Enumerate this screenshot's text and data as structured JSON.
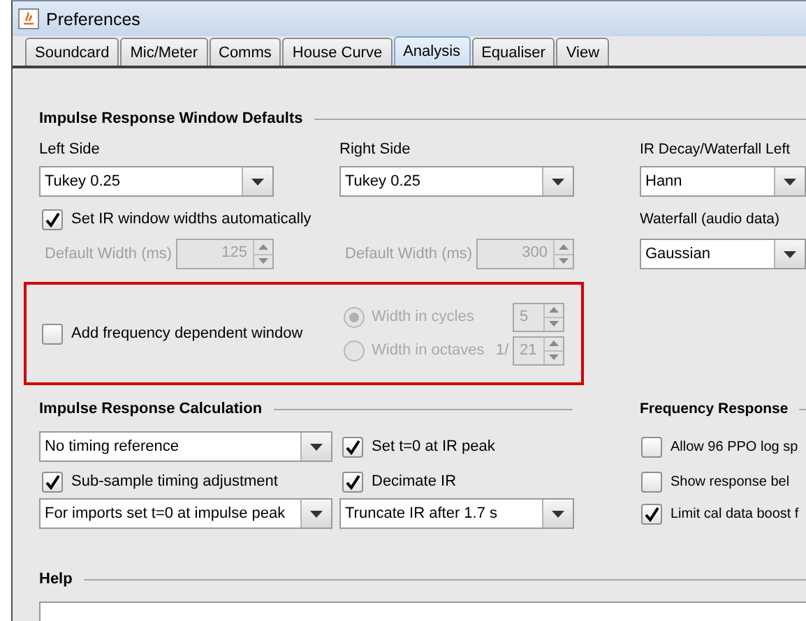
{
  "window": {
    "title": "Preferences"
  },
  "tabs": [
    {
      "label": "Soundcard",
      "selected": false
    },
    {
      "label": "Mic/Meter",
      "selected": false
    },
    {
      "label": "Comms",
      "selected": false
    },
    {
      "label": "House Curve",
      "selected": false
    },
    {
      "label": "Analysis",
      "selected": true
    },
    {
      "label": "Equaliser",
      "selected": false
    },
    {
      "label": "View",
      "selected": false
    }
  ],
  "ir_window_defaults": {
    "title": "Impulse Response Window Defaults",
    "left_side": {
      "label": "Left Side",
      "value": "Tukey 0.25"
    },
    "right_side": {
      "label": "Right Side",
      "value": "Tukey 0.25"
    },
    "ir_decay_left": {
      "label": "IR Decay/Waterfall Left",
      "value": "Hann"
    },
    "auto_widths": {
      "label": "Set IR window widths automatically",
      "checked": true
    },
    "waterfall": {
      "label": "Waterfall (audio data)",
      "value": "Gaussian"
    },
    "left_width": {
      "label": "Default Width (ms)",
      "value": "125",
      "disabled": true
    },
    "right_width": {
      "label": "Default Width (ms)",
      "value": "300",
      "disabled": true
    }
  },
  "freq_dependent": {
    "highlighted": true,
    "checkbox": {
      "label": "Add frequency dependent window",
      "checked": false
    },
    "options": [
      {
        "label": "Width in cycles",
        "selected": true,
        "disabled": true,
        "value": "5"
      },
      {
        "label": "Width in octaves",
        "selected": false,
        "disabled": true,
        "prefix": "1/",
        "value": "21"
      }
    ]
  },
  "ir_calculation": {
    "title": "Impulse Response Calculation",
    "timing_reference": {
      "value": "No timing reference"
    },
    "set_t0": {
      "label": "Set t=0 at IR peak",
      "checked": true
    },
    "sub_sample": {
      "label": "Sub-sample timing adjustment",
      "checked": true
    },
    "decimate": {
      "label": "Decimate IR",
      "checked": true
    },
    "imports_t0": {
      "value": "For imports set t=0 at impulse peak"
    },
    "truncate": {
      "value": "Truncate IR after 1.7 s"
    }
  },
  "frequency_response": {
    "title": "Frequency Response",
    "options": [
      {
        "label": "Allow 96 PPO log sp",
        "checked": false
      },
      {
        "label": "Show response bel",
        "checked": false
      },
      {
        "label": "Limit cal data boost f",
        "checked": true
      }
    ]
  },
  "help": {
    "title": "Help"
  }
}
